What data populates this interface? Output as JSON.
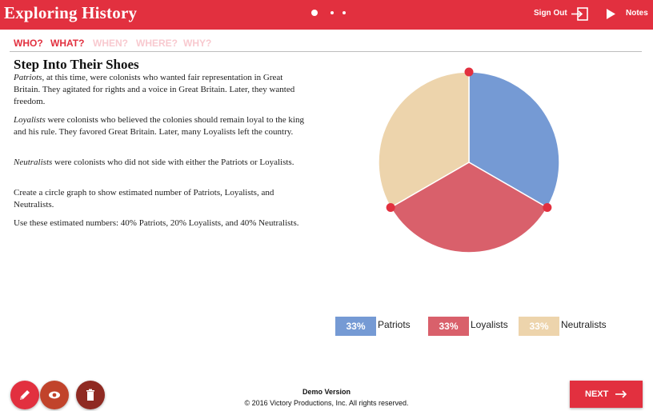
{
  "header": {
    "app_title": "Exploring History",
    "sign_out_label": "Sign Out",
    "notes_label": "Notes"
  },
  "tabs": [
    {
      "label": "WHO?",
      "active": true
    },
    {
      "label": "WHAT?",
      "active": true
    },
    {
      "label": "WHEN?",
      "active": false
    },
    {
      "label": "WHERE?",
      "active": false
    },
    {
      "label": "WHY?",
      "active": false
    }
  ],
  "content": {
    "title": "Step Into Their Shoes",
    "patriots": {
      "term": "Patriots",
      "text": ", at this time, were colonists who wanted fair representation in Great Britain. They agitated for rights and a voice in Great Britain. Later, they wanted freedom."
    },
    "loyalists": {
      "term": "Loyalists",
      "text": " were colonists who believed the colonies should remain loyal to the king and his rule. They favored Great Britain. Later, many Loyalists left the country."
    },
    "neutralists": {
      "term": "Neutralists",
      "text": " were colonists who did not side with either the Patriots or Loyalists."
    },
    "instruction": "Create a circle graph to show estimated number of Patriots, Loyalists, and Neutralists.",
    "numbers": "Use these estimated numbers: 40% Patriots, 20% Loyalists, and 40% Neutralists."
  },
  "chart_data": {
    "type": "pie",
    "slices": [
      {
        "name": "Patriots",
        "value": 33,
        "label": "33%",
        "color": "#759ad4"
      },
      {
        "name": "Loyalists",
        "value": 33,
        "label": "33%",
        "color": "#d9606b"
      },
      {
        "name": "Neutralists",
        "value": 33,
        "label": "33%",
        "color": "#edd4ac"
      }
    ],
    "handle_color": "#e2303f"
  },
  "footer": {
    "demo": "Demo Version",
    "copyright": "© 2016 Victory Productions, Inc. All rights reserved.",
    "next_label": "NEXT"
  },
  "tools": [
    {
      "name": "pencil-icon",
      "color": "#e2303f"
    },
    {
      "name": "eye-icon",
      "color": "#c1432b"
    },
    {
      "name": "trash-icon",
      "color": "#8f2a22"
    }
  ]
}
